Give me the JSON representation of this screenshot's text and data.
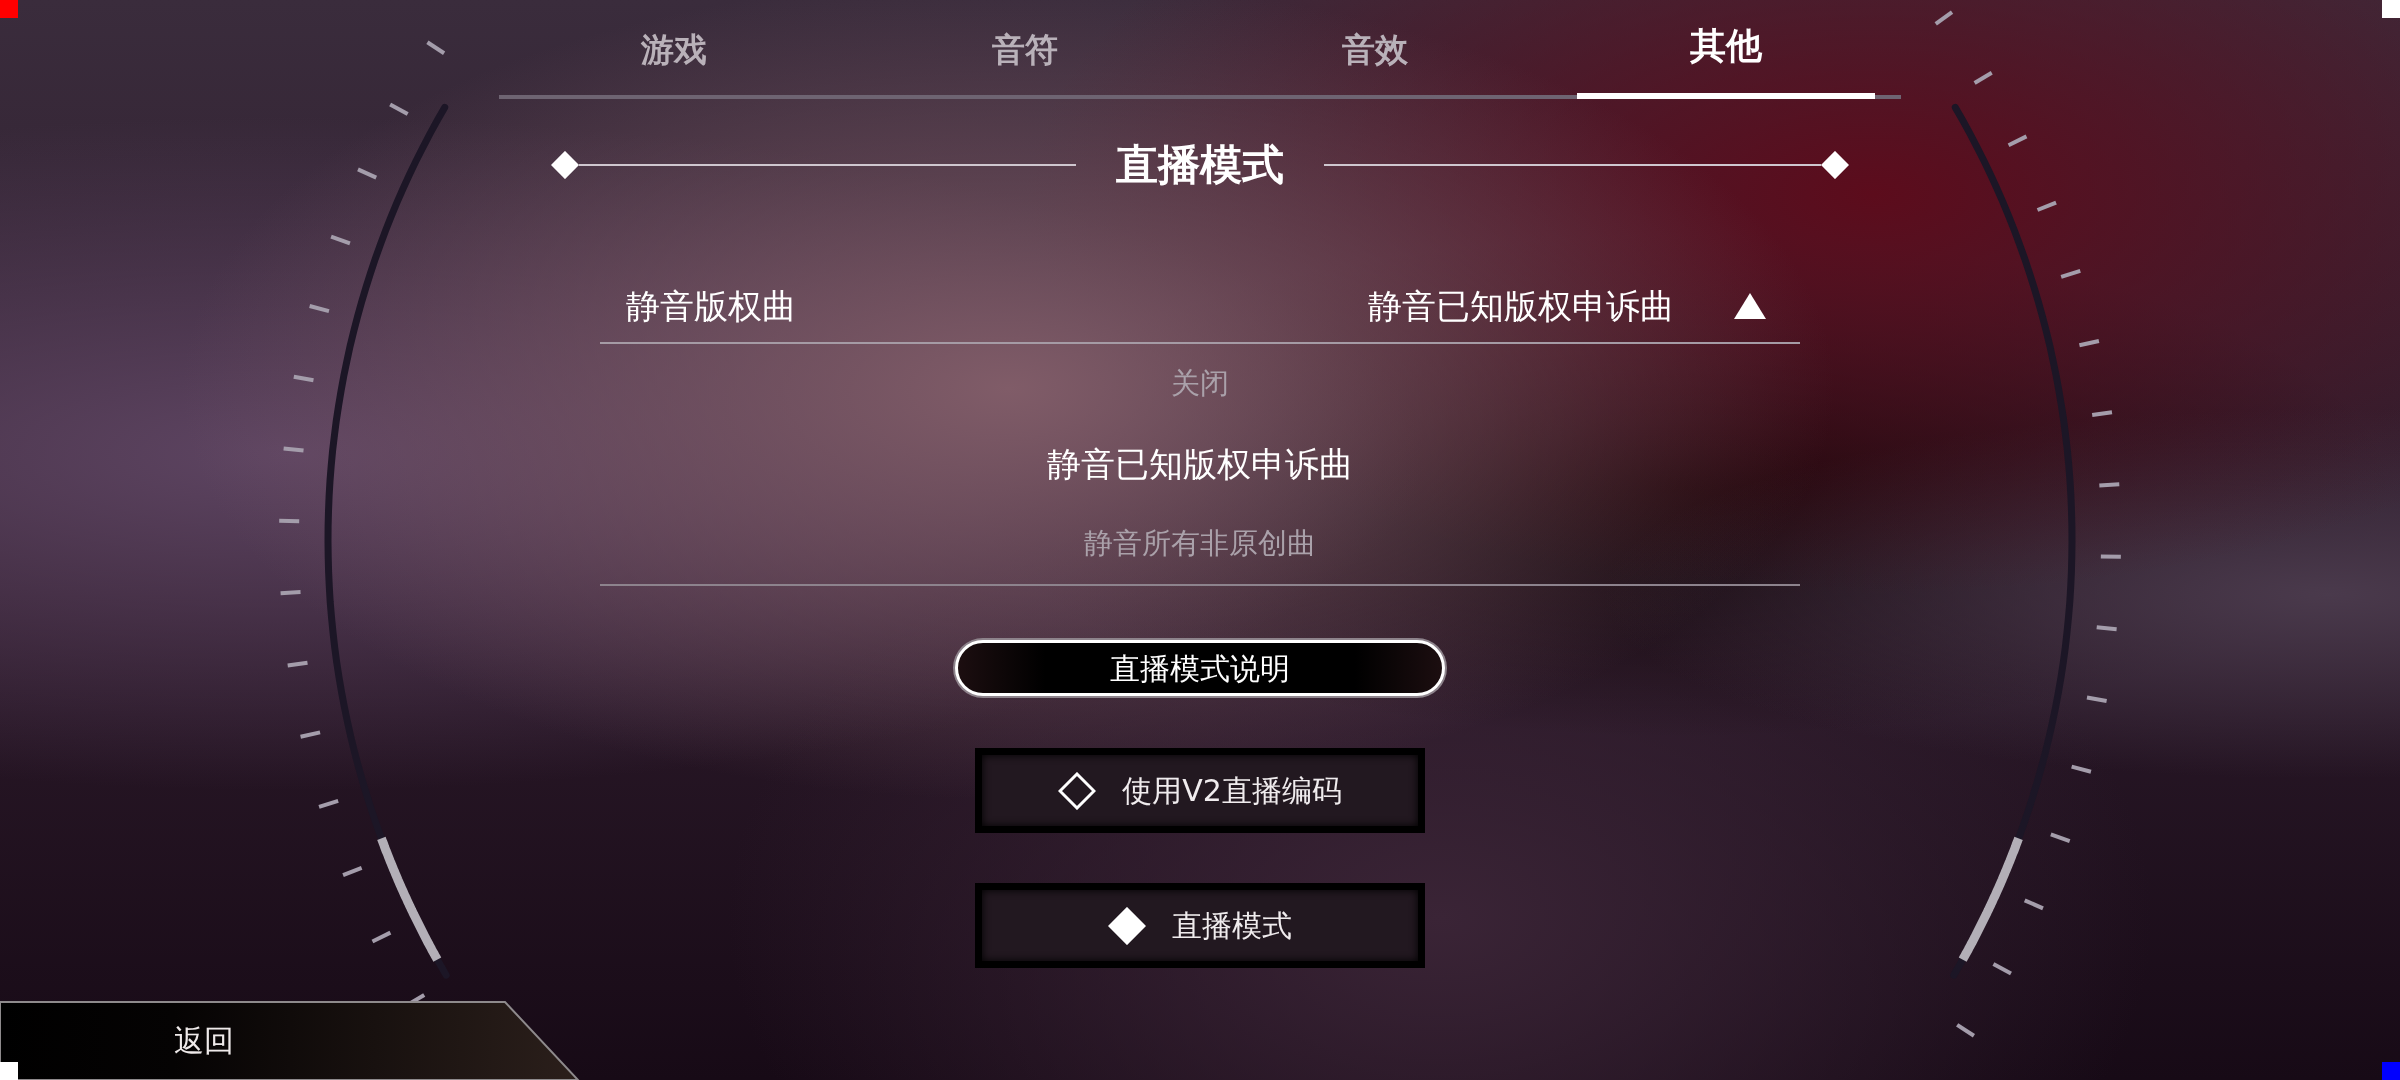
{
  "tabs": [
    {
      "label": "游戏",
      "selected": false
    },
    {
      "label": "音符",
      "selected": false
    },
    {
      "label": "音效",
      "selected": false
    },
    {
      "label": "其他",
      "selected": true
    }
  ],
  "section": {
    "title": "直播模式"
  },
  "dropdown": {
    "label": "静音版权曲",
    "value": "静音已知版权申诉曲",
    "expanded": true,
    "options": [
      {
        "label": "关闭",
        "selected": false
      },
      {
        "label": "静音已知版权申诉曲",
        "selected": true
      },
      {
        "label": "静音所有非原创曲",
        "selected": false
      }
    ]
  },
  "info_button": {
    "label": "直播模式说明"
  },
  "toggles": [
    {
      "label": "使用V2直播编码",
      "checked": false
    },
    {
      "label": "直播模式",
      "checked": true
    }
  ],
  "back_button": {
    "label": "返回"
  },
  "corner_markers": [
    {
      "kind": "topleft",
      "color": "#ff0000"
    },
    {
      "kind": "topright",
      "color": "#ffffff"
    },
    {
      "kind": "bottomleft",
      "color": "#ffffff"
    },
    {
      "kind": "bottomright",
      "color": "#0000ff"
    }
  ]
}
